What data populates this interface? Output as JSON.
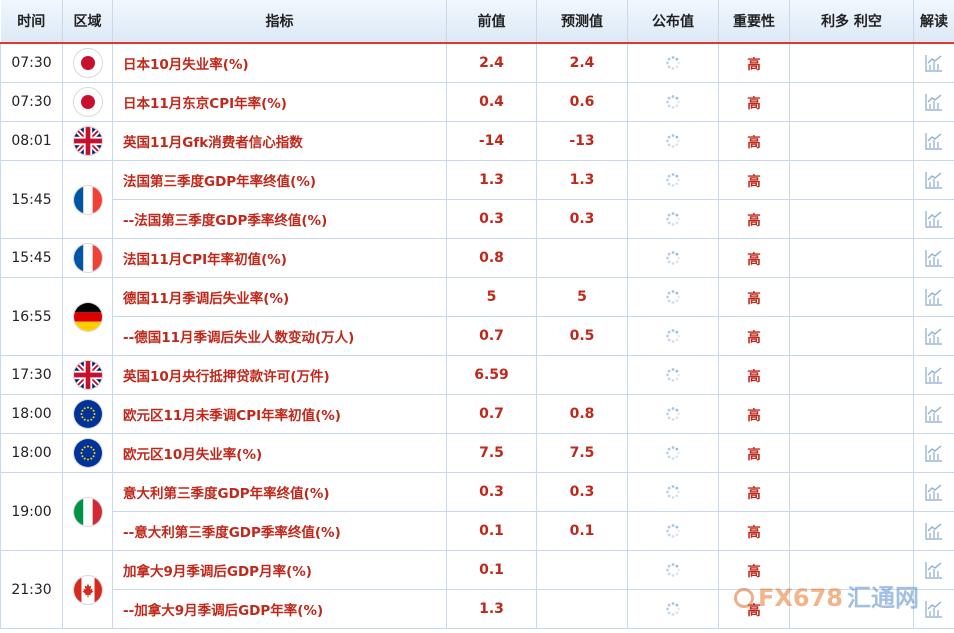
{
  "header": {
    "time": "时间",
    "region": "区域",
    "indicator": "指标",
    "previous": "前值",
    "forecast": "预测值",
    "actual": "公布值",
    "importance": "重要性",
    "impact": "利多 利空",
    "analysis": "解读"
  },
  "rows": [
    {
      "time": "07:30",
      "flag": "japan",
      "name": "日本10月失业率(%)",
      "prev": "2.4",
      "fcst": "2.4",
      "imp": "高"
    },
    {
      "time": "07:30",
      "flag": "japan",
      "name": "日本11月东京CPI年率(%)",
      "prev": "0.4",
      "fcst": "0.6",
      "imp": "高"
    },
    {
      "time": "08:01",
      "flag": "uk",
      "name": "英国11月Gfk消费者信心指数",
      "prev": "-14",
      "fcst": "-13",
      "imp": "高"
    },
    {
      "time": "15:45",
      "flag": "france",
      "name": "法国第三季度GDP年率终值(%)",
      "prev": "1.3",
      "fcst": "1.3",
      "imp": "高"
    },
    {
      "time": "",
      "flag": "",
      "name": "--法国第三季度GDP季率终值(%)",
      "prev": "0.3",
      "fcst": "0.3",
      "imp": "高"
    },
    {
      "time": "15:45",
      "flag": "france",
      "name": "法国11月CPI年率初值(%)",
      "prev": "0.8",
      "fcst": "",
      "imp": "高"
    },
    {
      "time": "16:55",
      "flag": "germany",
      "name": "德国11月季调后失业率(%)",
      "prev": "5",
      "fcst": "5",
      "imp": "高"
    },
    {
      "time": "",
      "flag": "",
      "name": "--德国11月季调后失业人数变动(万人)",
      "prev": "0.7",
      "fcst": "0.5",
      "imp": "高"
    },
    {
      "time": "17:30",
      "flag": "uk",
      "name": "英国10月央行抵押贷款许可(万件)",
      "prev": "6.59",
      "fcst": "",
      "imp": "高"
    },
    {
      "time": "18:00",
      "flag": "eu",
      "name": "欧元区11月未季调CPI年率初值(%)",
      "prev": "0.7",
      "fcst": "0.8",
      "imp": "高"
    },
    {
      "time": "18:00",
      "flag": "eu",
      "name": "欧元区10月失业率(%)",
      "prev": "7.5",
      "fcst": "7.5",
      "imp": "高"
    },
    {
      "time": "19:00",
      "flag": "italy",
      "name": "意大利第三季度GDP年率终值(%)",
      "prev": "0.3",
      "fcst": "0.3",
      "imp": "高"
    },
    {
      "time": "",
      "flag": "",
      "name": "--意大利第三季度GDP季率终值(%)",
      "prev": "0.1",
      "fcst": "0.1",
      "imp": "高"
    },
    {
      "time": "21:30",
      "flag": "canada",
      "name": "加拿大9月季调后GDP月率(%)",
      "prev": "0.1",
      "fcst": "",
      "imp": "高"
    },
    {
      "time": "",
      "flag": "",
      "name": "--加拿大9月季调后GDP年率(%)",
      "prev": "1.3",
      "fcst": "",
      "imp": "高"
    }
  ],
  "icons": {
    "pending": "loading-spinner-icon",
    "analysis": "chart-analysis-icon"
  },
  "colors": {
    "accent_red": "#c0281b",
    "header_border": "#d93b30",
    "grid": "#c9d9ea"
  },
  "watermark": {
    "brand": "FX678",
    "cn": "汇通网"
  }
}
